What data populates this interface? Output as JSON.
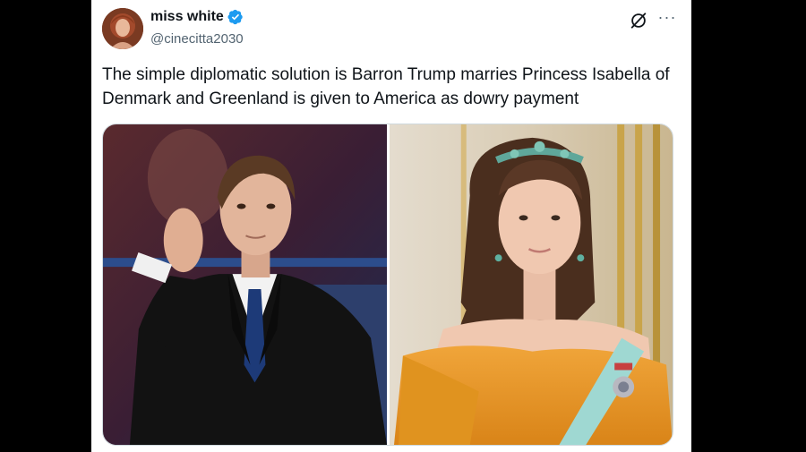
{
  "tweet": {
    "display_name": "miss white",
    "handle": "@cinecitta2030",
    "text": "The simple diplomatic solution is Barron Trump marries Princess Isabella of Denmark and Greenland is given to America as dowry payment",
    "more_label": "···"
  },
  "icons": {
    "verified": "verified-badge-icon",
    "grok": "grok-slash-icon",
    "more": "more-options-icon"
  },
  "colors": {
    "verified_blue": "#1d9bf0",
    "text_primary": "#0f1419",
    "text_secondary": "#536471"
  }
}
